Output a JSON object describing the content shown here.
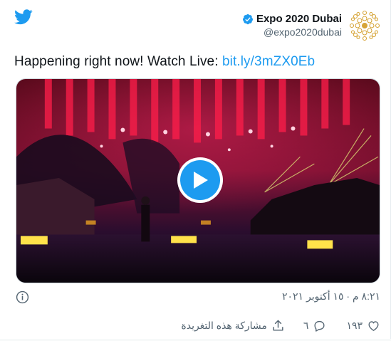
{
  "author": {
    "name": "Expo 2020 Dubai",
    "handle": "@expo2020dubai"
  },
  "tweet": {
    "text": "Happening right now! Watch Live: ",
    "link": "bit.ly/3mZX0Eb"
  },
  "meta": {
    "timestamp": "٨:٢١ م · ١٥ أكتوبر ٢٠٢١"
  },
  "actions": {
    "like_count": "١٩٣",
    "reply_count": "٦",
    "share_label": "مشاركة هذه التغريدة"
  },
  "colors": {
    "accent": "#1d9bf0",
    "text": "#0f1419",
    "muted": "#536471",
    "expo_gold": "#d6a437"
  },
  "icons": {
    "brand": "twitter-bird-icon",
    "verified": "verified-badge-icon",
    "info": "info-icon",
    "play": "play-icon",
    "like": "heart-icon",
    "reply": "reply-bubble-icon",
    "share": "share-upload-icon"
  }
}
